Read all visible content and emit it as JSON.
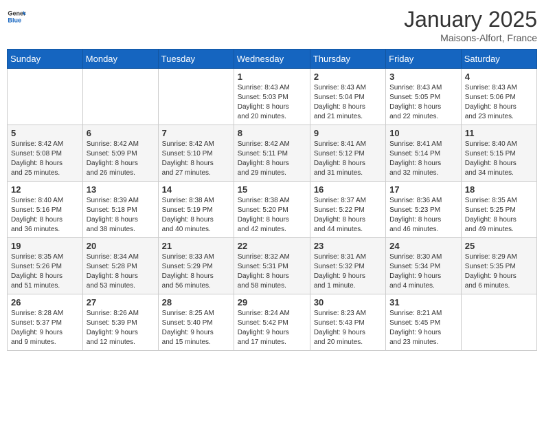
{
  "header": {
    "logo_general": "General",
    "logo_blue": "Blue",
    "title": "January 2025",
    "subtitle": "Maisons-Alfort, France"
  },
  "days_of_week": [
    "Sunday",
    "Monday",
    "Tuesday",
    "Wednesday",
    "Thursday",
    "Friday",
    "Saturday"
  ],
  "weeks": [
    [
      {
        "day": "",
        "info": ""
      },
      {
        "day": "",
        "info": ""
      },
      {
        "day": "",
        "info": ""
      },
      {
        "day": "1",
        "info": "Sunrise: 8:43 AM\nSunset: 5:03 PM\nDaylight: 8 hours\nand 20 minutes."
      },
      {
        "day": "2",
        "info": "Sunrise: 8:43 AM\nSunset: 5:04 PM\nDaylight: 8 hours\nand 21 minutes."
      },
      {
        "day": "3",
        "info": "Sunrise: 8:43 AM\nSunset: 5:05 PM\nDaylight: 8 hours\nand 22 minutes."
      },
      {
        "day": "4",
        "info": "Sunrise: 8:43 AM\nSunset: 5:06 PM\nDaylight: 8 hours\nand 23 minutes."
      }
    ],
    [
      {
        "day": "5",
        "info": "Sunrise: 8:42 AM\nSunset: 5:08 PM\nDaylight: 8 hours\nand 25 minutes."
      },
      {
        "day": "6",
        "info": "Sunrise: 8:42 AM\nSunset: 5:09 PM\nDaylight: 8 hours\nand 26 minutes."
      },
      {
        "day": "7",
        "info": "Sunrise: 8:42 AM\nSunset: 5:10 PM\nDaylight: 8 hours\nand 27 minutes."
      },
      {
        "day": "8",
        "info": "Sunrise: 8:42 AM\nSunset: 5:11 PM\nDaylight: 8 hours\nand 29 minutes."
      },
      {
        "day": "9",
        "info": "Sunrise: 8:41 AM\nSunset: 5:12 PM\nDaylight: 8 hours\nand 31 minutes."
      },
      {
        "day": "10",
        "info": "Sunrise: 8:41 AM\nSunset: 5:14 PM\nDaylight: 8 hours\nand 32 minutes."
      },
      {
        "day": "11",
        "info": "Sunrise: 8:40 AM\nSunset: 5:15 PM\nDaylight: 8 hours\nand 34 minutes."
      }
    ],
    [
      {
        "day": "12",
        "info": "Sunrise: 8:40 AM\nSunset: 5:16 PM\nDaylight: 8 hours\nand 36 minutes."
      },
      {
        "day": "13",
        "info": "Sunrise: 8:39 AM\nSunset: 5:18 PM\nDaylight: 8 hours\nand 38 minutes."
      },
      {
        "day": "14",
        "info": "Sunrise: 8:38 AM\nSunset: 5:19 PM\nDaylight: 8 hours\nand 40 minutes."
      },
      {
        "day": "15",
        "info": "Sunrise: 8:38 AM\nSunset: 5:20 PM\nDaylight: 8 hours\nand 42 minutes."
      },
      {
        "day": "16",
        "info": "Sunrise: 8:37 AM\nSunset: 5:22 PM\nDaylight: 8 hours\nand 44 minutes."
      },
      {
        "day": "17",
        "info": "Sunrise: 8:36 AM\nSunset: 5:23 PM\nDaylight: 8 hours\nand 46 minutes."
      },
      {
        "day": "18",
        "info": "Sunrise: 8:35 AM\nSunset: 5:25 PM\nDaylight: 8 hours\nand 49 minutes."
      }
    ],
    [
      {
        "day": "19",
        "info": "Sunrise: 8:35 AM\nSunset: 5:26 PM\nDaylight: 8 hours\nand 51 minutes."
      },
      {
        "day": "20",
        "info": "Sunrise: 8:34 AM\nSunset: 5:28 PM\nDaylight: 8 hours\nand 53 minutes."
      },
      {
        "day": "21",
        "info": "Sunrise: 8:33 AM\nSunset: 5:29 PM\nDaylight: 8 hours\nand 56 minutes."
      },
      {
        "day": "22",
        "info": "Sunrise: 8:32 AM\nSunset: 5:31 PM\nDaylight: 8 hours\nand 58 minutes."
      },
      {
        "day": "23",
        "info": "Sunrise: 8:31 AM\nSunset: 5:32 PM\nDaylight: 9 hours\nand 1 minute."
      },
      {
        "day": "24",
        "info": "Sunrise: 8:30 AM\nSunset: 5:34 PM\nDaylight: 9 hours\nand 4 minutes."
      },
      {
        "day": "25",
        "info": "Sunrise: 8:29 AM\nSunset: 5:35 PM\nDaylight: 9 hours\nand 6 minutes."
      }
    ],
    [
      {
        "day": "26",
        "info": "Sunrise: 8:28 AM\nSunset: 5:37 PM\nDaylight: 9 hours\nand 9 minutes."
      },
      {
        "day": "27",
        "info": "Sunrise: 8:26 AM\nSunset: 5:39 PM\nDaylight: 9 hours\nand 12 minutes."
      },
      {
        "day": "28",
        "info": "Sunrise: 8:25 AM\nSunset: 5:40 PM\nDaylight: 9 hours\nand 15 minutes."
      },
      {
        "day": "29",
        "info": "Sunrise: 8:24 AM\nSunset: 5:42 PM\nDaylight: 9 hours\nand 17 minutes."
      },
      {
        "day": "30",
        "info": "Sunrise: 8:23 AM\nSunset: 5:43 PM\nDaylight: 9 hours\nand 20 minutes."
      },
      {
        "day": "31",
        "info": "Sunrise: 8:21 AM\nSunset: 5:45 PM\nDaylight: 9 hours\nand 23 minutes."
      },
      {
        "day": "",
        "info": ""
      }
    ]
  ]
}
